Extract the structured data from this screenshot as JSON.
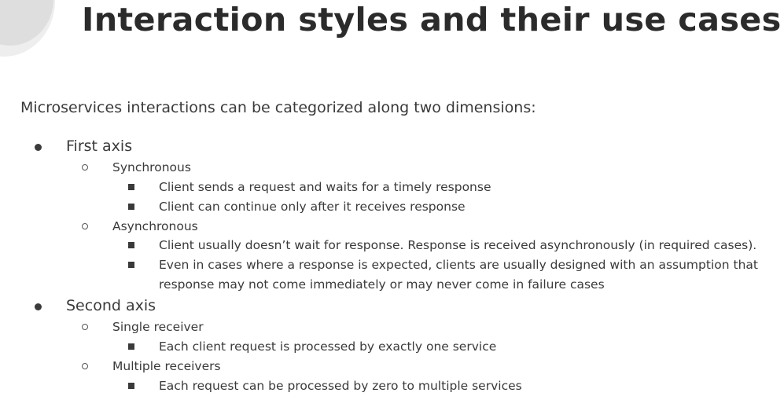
{
  "slide": {
    "title": "Interaction styles and their use cases",
    "intro": "Microservices interactions can be categorized along two dimensions:"
  },
  "axes": [
    {
      "label": "First axis",
      "styles": [
        {
          "label": "Synchronous",
          "points": [
            "Client sends a request and waits for a timely response",
            "Client can continue only after it receives response"
          ]
        },
        {
          "label": "Asynchronous",
          "points": [
            "Client usually doesn’t wait for response. Response is received asynchronously (in required cases).",
            "Even in cases where a response is expected, clients are usually designed with an assumption that",
            "response may not come immediately or may never come in failure cases"
          ]
        }
      ]
    },
    {
      "label": "Second axis",
      "styles": [
        {
          "label": "Single receiver",
          "points": [
            "Each client request is processed by exactly one service"
          ]
        },
        {
          "label": "Multiple receivers",
          "points": [
            "Each request can be processed by zero to multiple services"
          ]
        }
      ]
    }
  ]
}
